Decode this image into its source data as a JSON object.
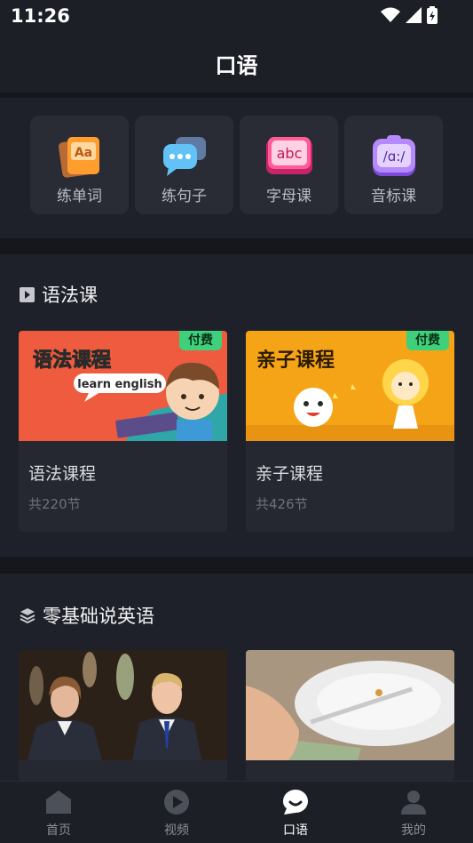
{
  "status": {
    "time": "11:26"
  },
  "header": {
    "title": "口语"
  },
  "quick": [
    {
      "label": "练单词",
      "icon": "flashcard-icon",
      "glyph": "Aa"
    },
    {
      "label": "练句子",
      "icon": "chat-bubble-icon",
      "glyph": "•••"
    },
    {
      "label": "字母课",
      "icon": "abc-icon",
      "glyph": "abc"
    },
    {
      "label": "音标课",
      "icon": "phonetic-icon",
      "glyph": "/ɑ:/"
    }
  ],
  "grammar": {
    "title": "语法课",
    "cards": [
      {
        "thumb_title": "语法课程",
        "thumb_bubble": "learn english",
        "badge": "付费",
        "title": "语法课程",
        "count": "共220节"
      },
      {
        "thumb_title": "亲子课程",
        "badge": "付费",
        "title": "亲子课程",
        "count": "共426节"
      }
    ]
  },
  "zero": {
    "title": "零基础说英语"
  },
  "tabs": [
    {
      "label": "首页",
      "icon": "home-icon"
    },
    {
      "label": "视频",
      "icon": "video-icon"
    },
    {
      "label": "口语",
      "icon": "speech-icon",
      "active": true
    },
    {
      "label": "我的",
      "icon": "profile-icon"
    }
  ],
  "colors": {
    "accent": "#3ed07a",
    "background": "#15171c",
    "panel": "#1e2129"
  }
}
